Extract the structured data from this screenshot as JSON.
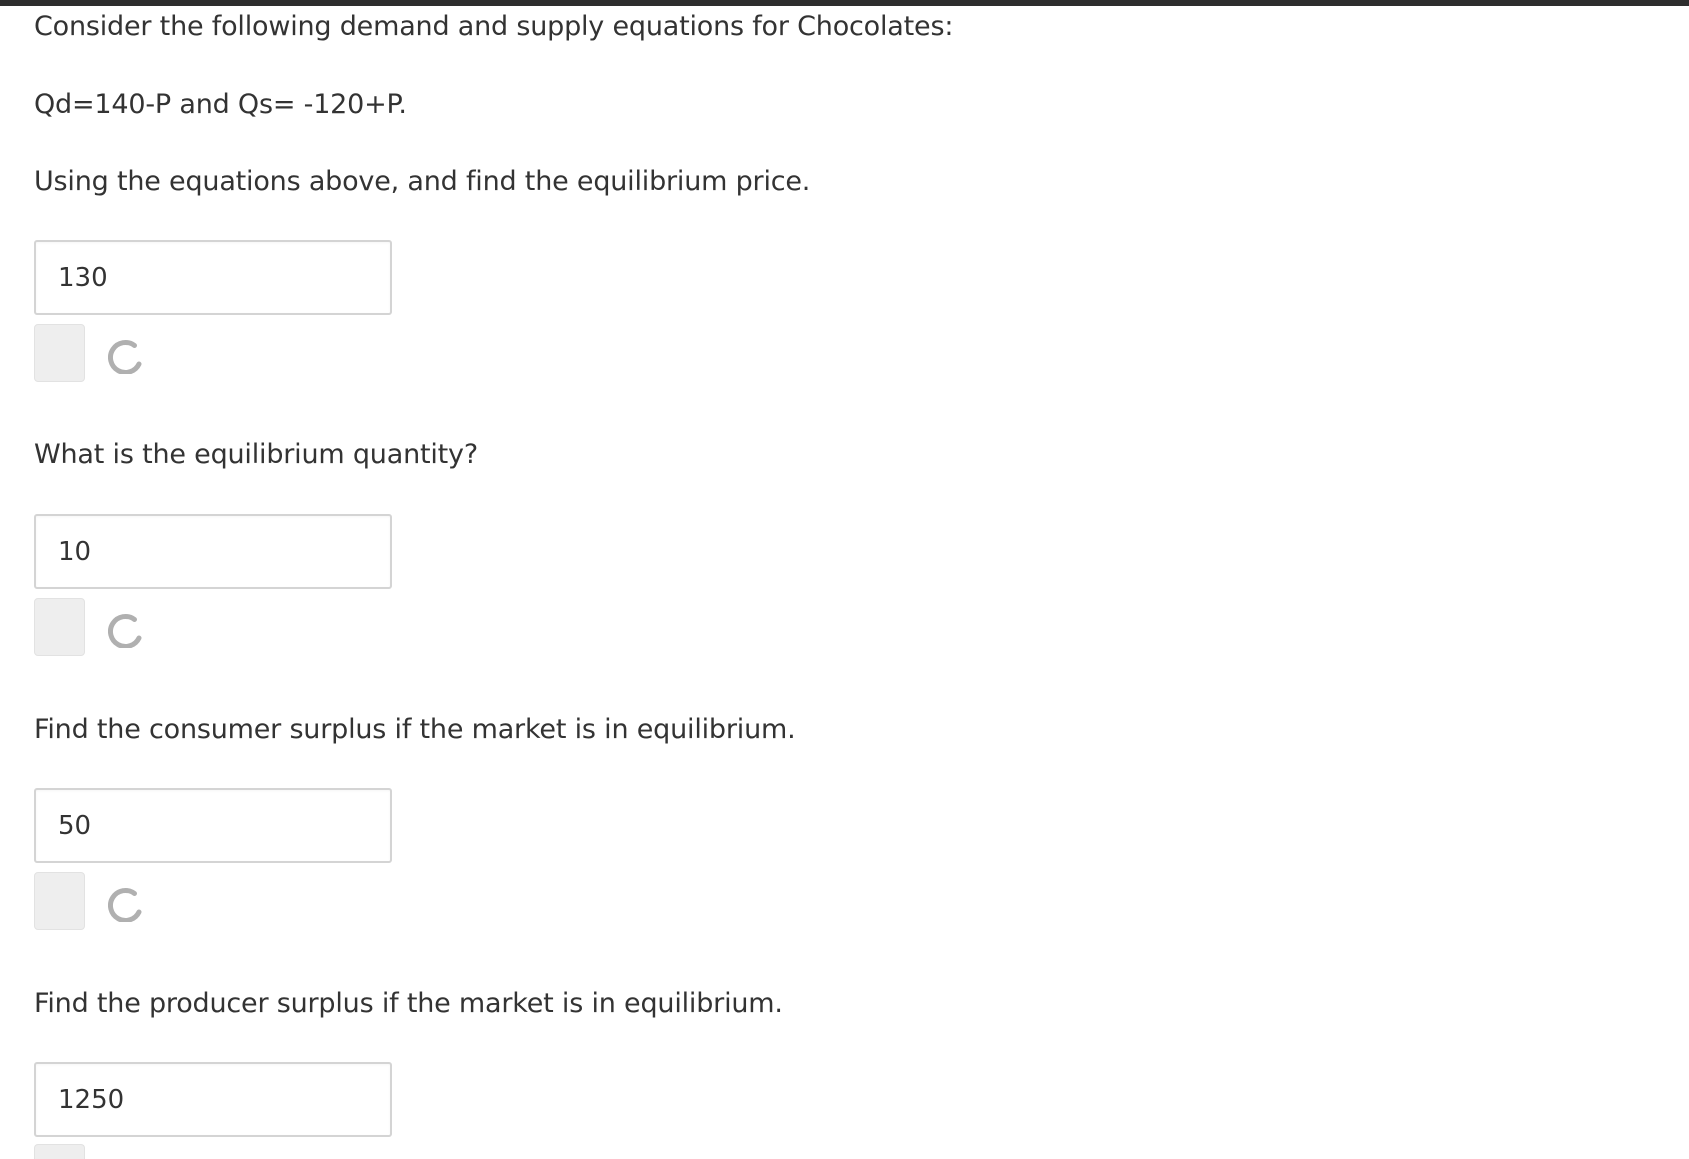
{
  "question": {
    "intro": "Consider the following demand and supply equations for Chocolates:",
    "equations": "Qd=140-P and Qs= -120+P."
  },
  "parts": [
    {
      "prompt": "Using the equations above, and find the equilibrium price.",
      "answer": "130"
    },
    {
      "prompt": "What is the equilibrium quantity?",
      "answer": "10"
    },
    {
      "prompt": "Find the consumer surplus if the market is in equilibrium.",
      "answer": "50"
    },
    {
      "prompt": "Find the producer surplus if the market is in equilibrium.",
      "answer": "1250"
    }
  ],
  "icons": {
    "spinner": "loading-spinner-icon",
    "check_button": "submit-check-button"
  },
  "colors": {
    "text": "#333333",
    "top_bar": "#2e2e2e",
    "input_border": "#d4d4d4",
    "check_button_bg": "#eeeeee",
    "spinner": "#b0b0b0"
  }
}
